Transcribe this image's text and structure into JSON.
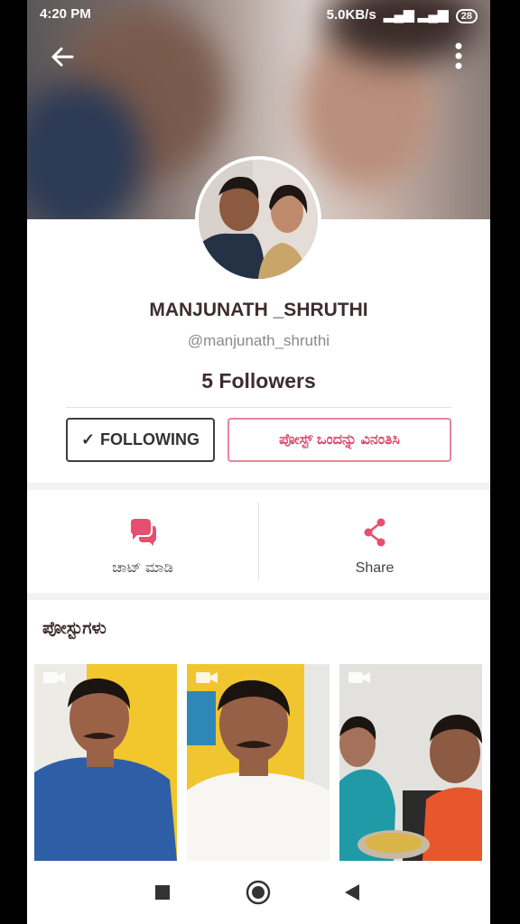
{
  "status_bar": {
    "time": "4:20 PM",
    "network_speed": "5.0KB/s",
    "battery": "28"
  },
  "profile": {
    "name": "MANJUNATH _SHRUTHI",
    "handle": "@manjunath_shruthi",
    "followers": "5 Followers"
  },
  "buttons": {
    "following": "FOLLOWING",
    "request_post": "ಪೋಸ್ಟ್ ಒಂದನ್ನು ವಿನಂತಿಸಿ"
  },
  "actions": {
    "chat": "ಚಾಟ್ ಮಾಡಿ",
    "share": "Share"
  },
  "posts": {
    "title": "ಪೋಸ್ಟುಗಳು",
    "items": [
      {
        "type": "video-icon"
      },
      {
        "type": "video-icon"
      },
      {
        "type": "video-icon"
      }
    ]
  },
  "colors": {
    "accent": "#d9456b",
    "text_dark": "#3e2d2f",
    "muted": "#8a8a8a"
  },
  "icons": [
    "back-arrow-icon",
    "more-vert-icon",
    "chat-bubbles-icon",
    "share-icon",
    "video-camera-icon",
    "square-nav-icon",
    "home-circle-nav-icon",
    "back-triangle-nav-icon"
  ]
}
